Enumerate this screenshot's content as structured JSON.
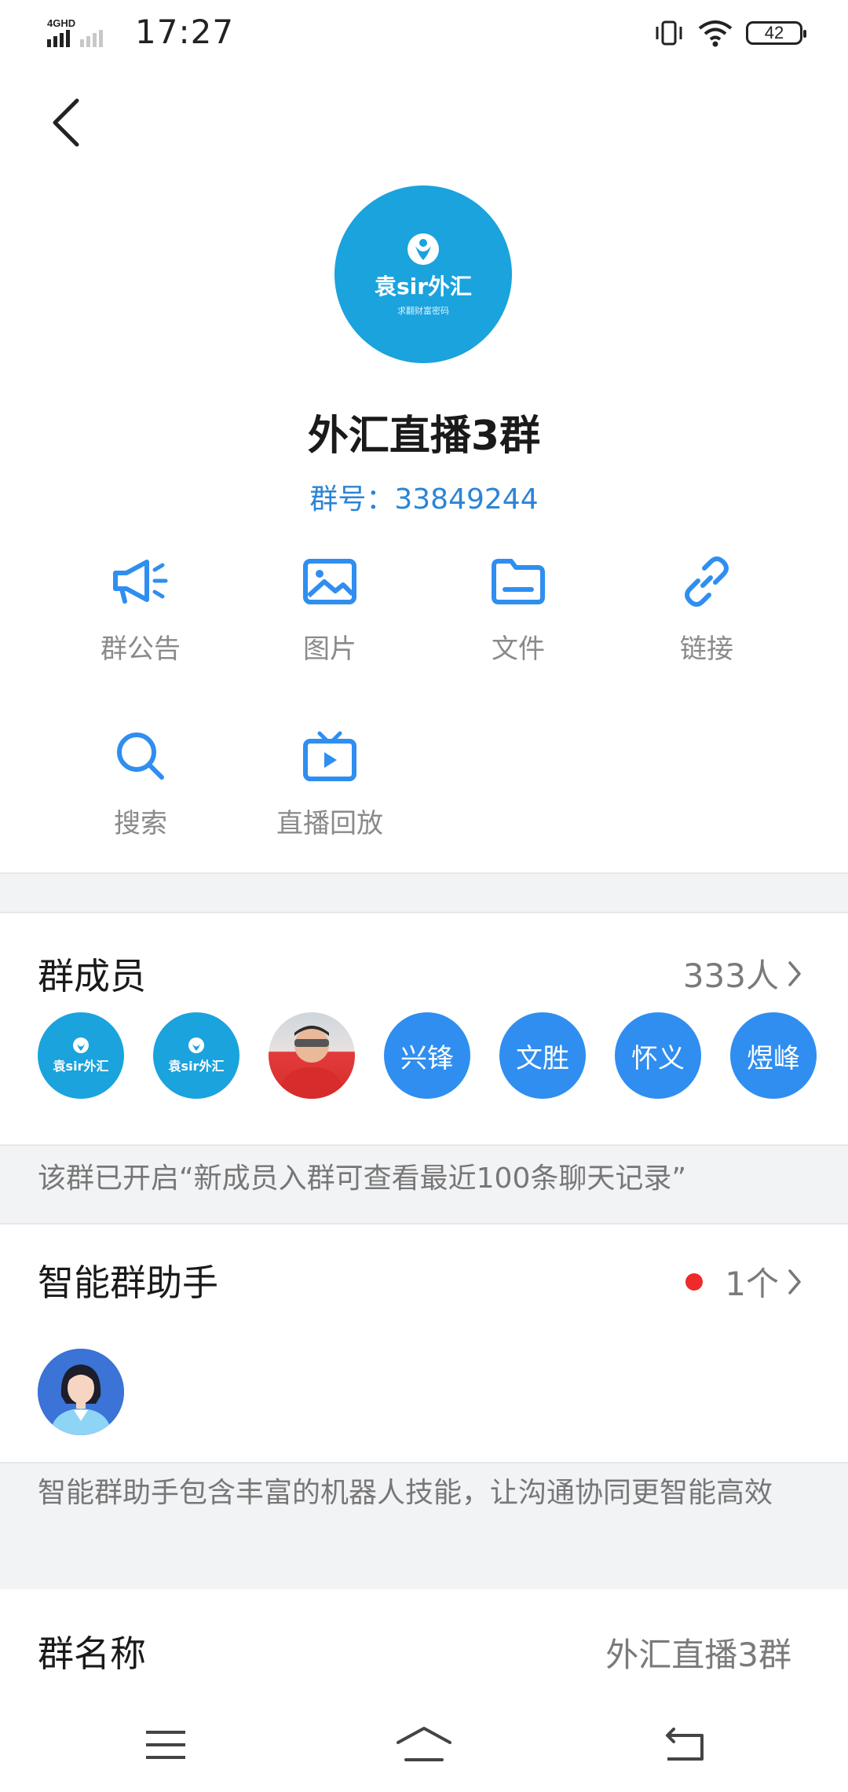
{
  "status_bar": {
    "network": "4GHD",
    "time": "17:27",
    "battery": "42"
  },
  "group": {
    "avatar_brand": "袁sir外汇",
    "avatar_tagline": "求翻财富密码",
    "name": "外汇直播3群",
    "id_text": "群号：33849244"
  },
  "functions": [
    {
      "label": "群公告",
      "icon": "megaphone-icon"
    },
    {
      "label": "图片",
      "icon": "image-icon"
    },
    {
      "label": "文件",
      "icon": "folder-icon"
    },
    {
      "label": "链接",
      "icon": "link-icon"
    },
    {
      "label": "搜索",
      "icon": "search-icon"
    },
    {
      "label": "直播回放",
      "icon": "tv-icon"
    }
  ],
  "members": {
    "title": "群成员",
    "count": "333人",
    "avatars": [
      {
        "type": "logo",
        "text": "袁sir外汇"
      },
      {
        "type": "logo",
        "text": "袁sir外汇"
      },
      {
        "type": "photo",
        "text": ""
      },
      {
        "type": "initials",
        "text": "兴锋"
      },
      {
        "type": "initials",
        "text": "文胜"
      },
      {
        "type": "initials",
        "text": "怀义"
      },
      {
        "type": "initials",
        "text": "煜峰"
      }
    ]
  },
  "history_notice": "该群已开启“新成员入群可查看最近100条聊天记录”",
  "assistant": {
    "title": "智能群助手",
    "count": "1个",
    "description": "智能群助手包含丰富的机器人技能，让沟通协同更智能高效"
  },
  "group_name_row": {
    "label": "群名称",
    "value": "外汇直播3群"
  },
  "colors": {
    "accent": "#2f8ef0",
    "link": "#2b84d6",
    "brand_teal": "#1aa3dd",
    "red_dot": "#ee2a2a"
  }
}
